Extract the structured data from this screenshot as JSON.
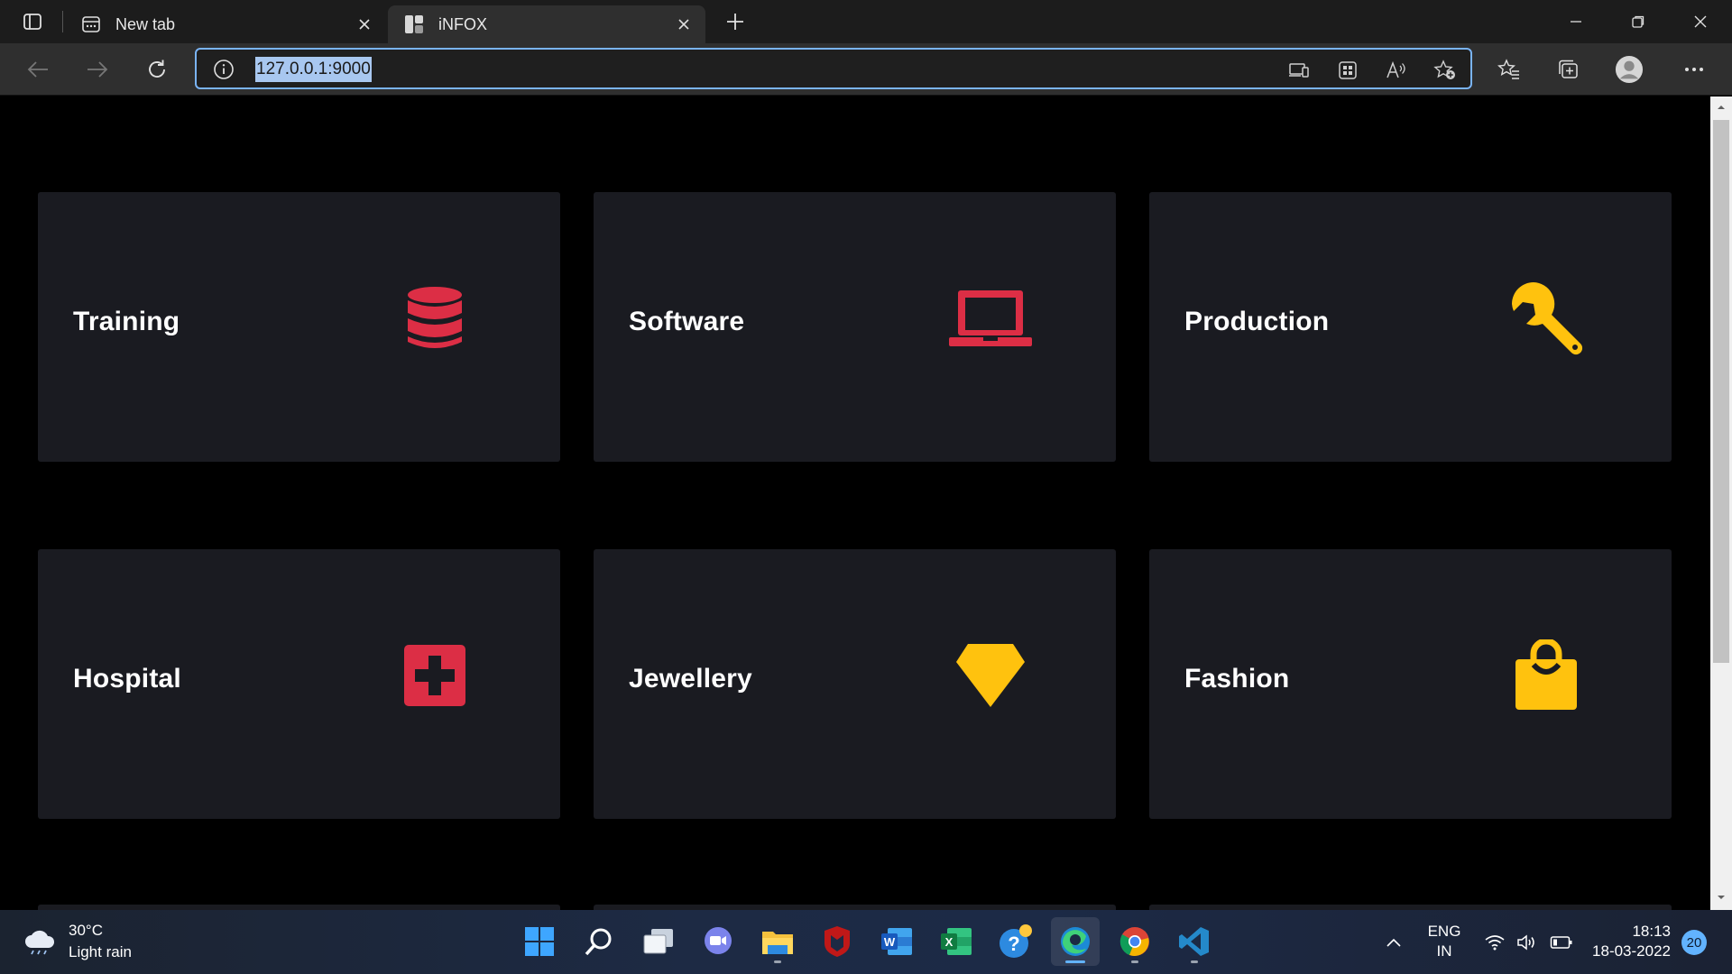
{
  "browser": {
    "tabs": [
      {
        "label": "New tab",
        "icon": "newtab-icon",
        "active": false
      },
      {
        "label": "iNFOX",
        "icon": "site-favicon",
        "active": true
      }
    ],
    "address": {
      "url": "127.0.0.1:9000",
      "selected": true
    },
    "accent_color": "#7ab4f5"
  },
  "page": {
    "background": "#000000",
    "card_color": "#1a1b21",
    "cards": [
      {
        "title": "Training",
        "icon": "database-icon",
        "icon_color": "#dc2e45"
      },
      {
        "title": "Software",
        "icon": "laptop-icon",
        "icon_color": "#dc2e45"
      },
      {
        "title": "Production",
        "icon": "wrench-icon",
        "icon_color": "#ffc20e"
      },
      {
        "title": "Hospital",
        "icon": "first-aid-icon",
        "icon_color": "#dc2e45"
      },
      {
        "title": "Jewellery",
        "icon": "diamond-icon",
        "icon_color": "#ffc20e"
      },
      {
        "title": "Fashion",
        "icon": "shopping-bag-icon",
        "icon_color": "#ffc20e"
      }
    ]
  },
  "taskbar": {
    "weather": {
      "temp": "30°C",
      "condition": "Light rain",
      "icon": "cloud-rain-icon"
    },
    "apps": [
      "windows-start-icon",
      "search-icon",
      "task-view-icon",
      "teams-chat-icon",
      "file-explorer-icon",
      "mcafee-icon",
      "word-icon",
      "excel-icon",
      "help-icon",
      "edge-icon",
      "chrome-icon",
      "vscode-icon"
    ],
    "tray": {
      "lang_top": "ENG",
      "lang_bottom": "IN",
      "time": "18:13",
      "date": "18-03-2022",
      "notification_count": "20"
    }
  }
}
